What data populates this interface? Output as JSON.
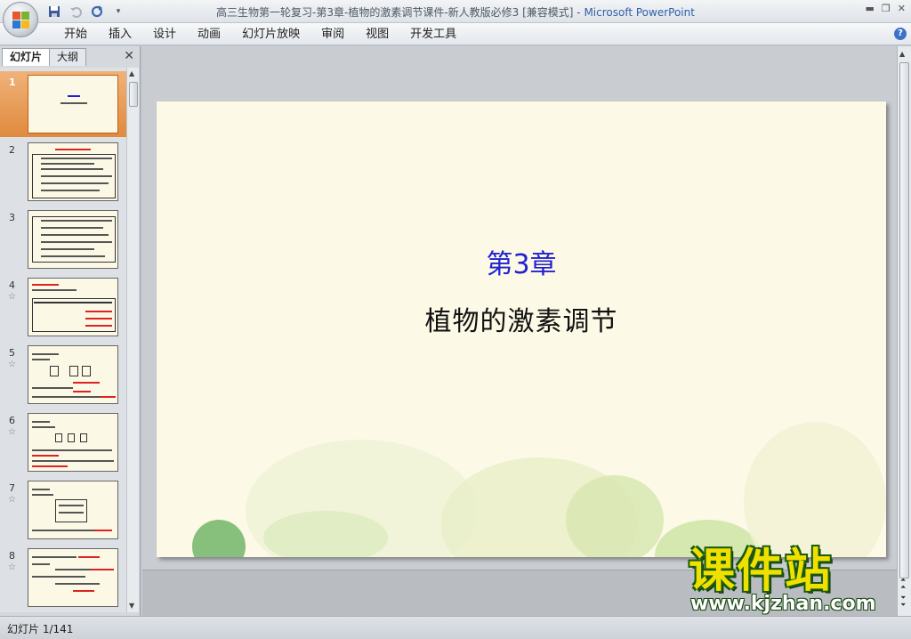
{
  "window": {
    "title": "高三生物第一轮复习-第3章-植物的激素调节课件-新人教版必修3 [兼容模式]",
    "app_name": "Microsoft PowerPoint",
    "separator": " - "
  },
  "quick_access": {
    "save_icon": "save-icon",
    "undo_icon": "undo-icon",
    "redo_icon": "redo-icon",
    "customize_icon": "customize-qat-icon"
  },
  "menu": {
    "items": [
      "开始",
      "插入",
      "设计",
      "动画",
      "幻灯片放映",
      "审阅",
      "视图",
      "开发工具"
    ]
  },
  "panel": {
    "tabs": [
      "幻灯片",
      "大纲"
    ],
    "active_tab": "幻灯片",
    "slides": [
      {
        "num": "1",
        "starred": false
      },
      {
        "num": "2",
        "starred": false
      },
      {
        "num": "3",
        "starred": false
      },
      {
        "num": "4",
        "starred": true
      },
      {
        "num": "5",
        "starred": true
      },
      {
        "num": "6",
        "starred": true
      },
      {
        "num": "7",
        "starred": true
      },
      {
        "num": "8",
        "starred": true
      }
    ],
    "selected": "1"
  },
  "slide": {
    "title": "第3章",
    "subtitle": "植物的激素调节",
    "title_color": "#2020d0",
    "background": "#fcf9e6"
  },
  "status": {
    "text": "幻灯片 1/141"
  },
  "watermark": {
    "text": "课件站",
    "url": "www.kjzhan.com"
  },
  "colors": {
    "selected_thumb": "#e08a3e",
    "app_title": "#3060a8"
  }
}
